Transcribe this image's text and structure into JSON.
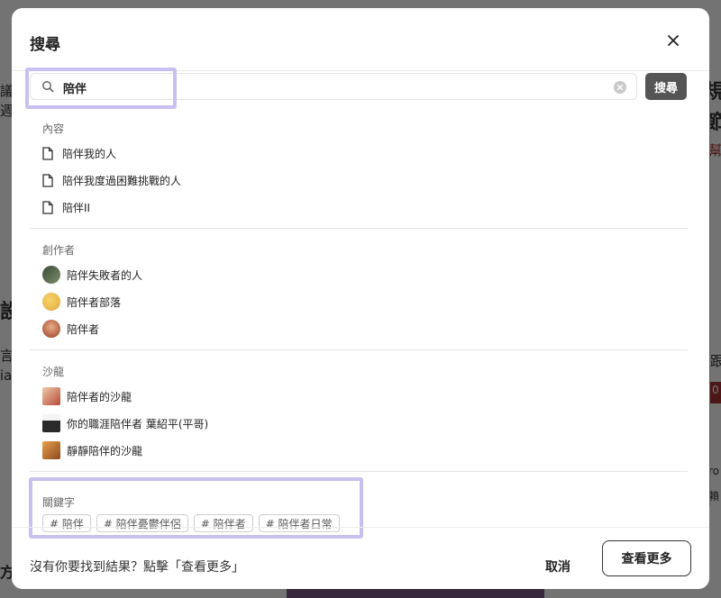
{
  "modal": {
    "title": "搜尋",
    "search": {
      "value": "陪伴",
      "button_label": "搜尋"
    },
    "sections": {
      "content": {
        "label": "內容",
        "items": [
          "陪伴我的人",
          "陪伴我度過困難挑戰的人",
          "陪伴II"
        ]
      },
      "creators": {
        "label": "創作者",
        "items": [
          "陪伴失敗者的人",
          "陪伴者部落",
          "陪伴者"
        ]
      },
      "salons": {
        "label": "沙龍",
        "items": [
          "陪伴者的沙龍",
          "你的職涯陪伴者 葉紹平(平哥)",
          "靜靜陪伴的沙龍"
        ]
      },
      "keywords": {
        "label": "關鍵字",
        "tags": [
          "# 陪伴",
          "# 陪伴憂鬱伴侶",
          "# 陪伴者",
          "# 陪伴者日常"
        ]
      }
    },
    "footer": {
      "hint": "沒有你要找到結果？點擊「查看更多」",
      "cancel_label": "取消",
      "more_label": "查看更多"
    }
  },
  "background": {
    "left_fragments": [
      "議",
      "週",
      "設",
      "言",
      "ia",
      "方"
    ],
    "right_fragments": [
      "規",
      "節",
      "幫",
      "跟",
      "0",
      "ro",
      "賴"
    ]
  },
  "colors": {
    "highlight": "#c9c0ef",
    "search_button": "#555555",
    "overlay": "rgba(0,0,0,0.55)"
  }
}
